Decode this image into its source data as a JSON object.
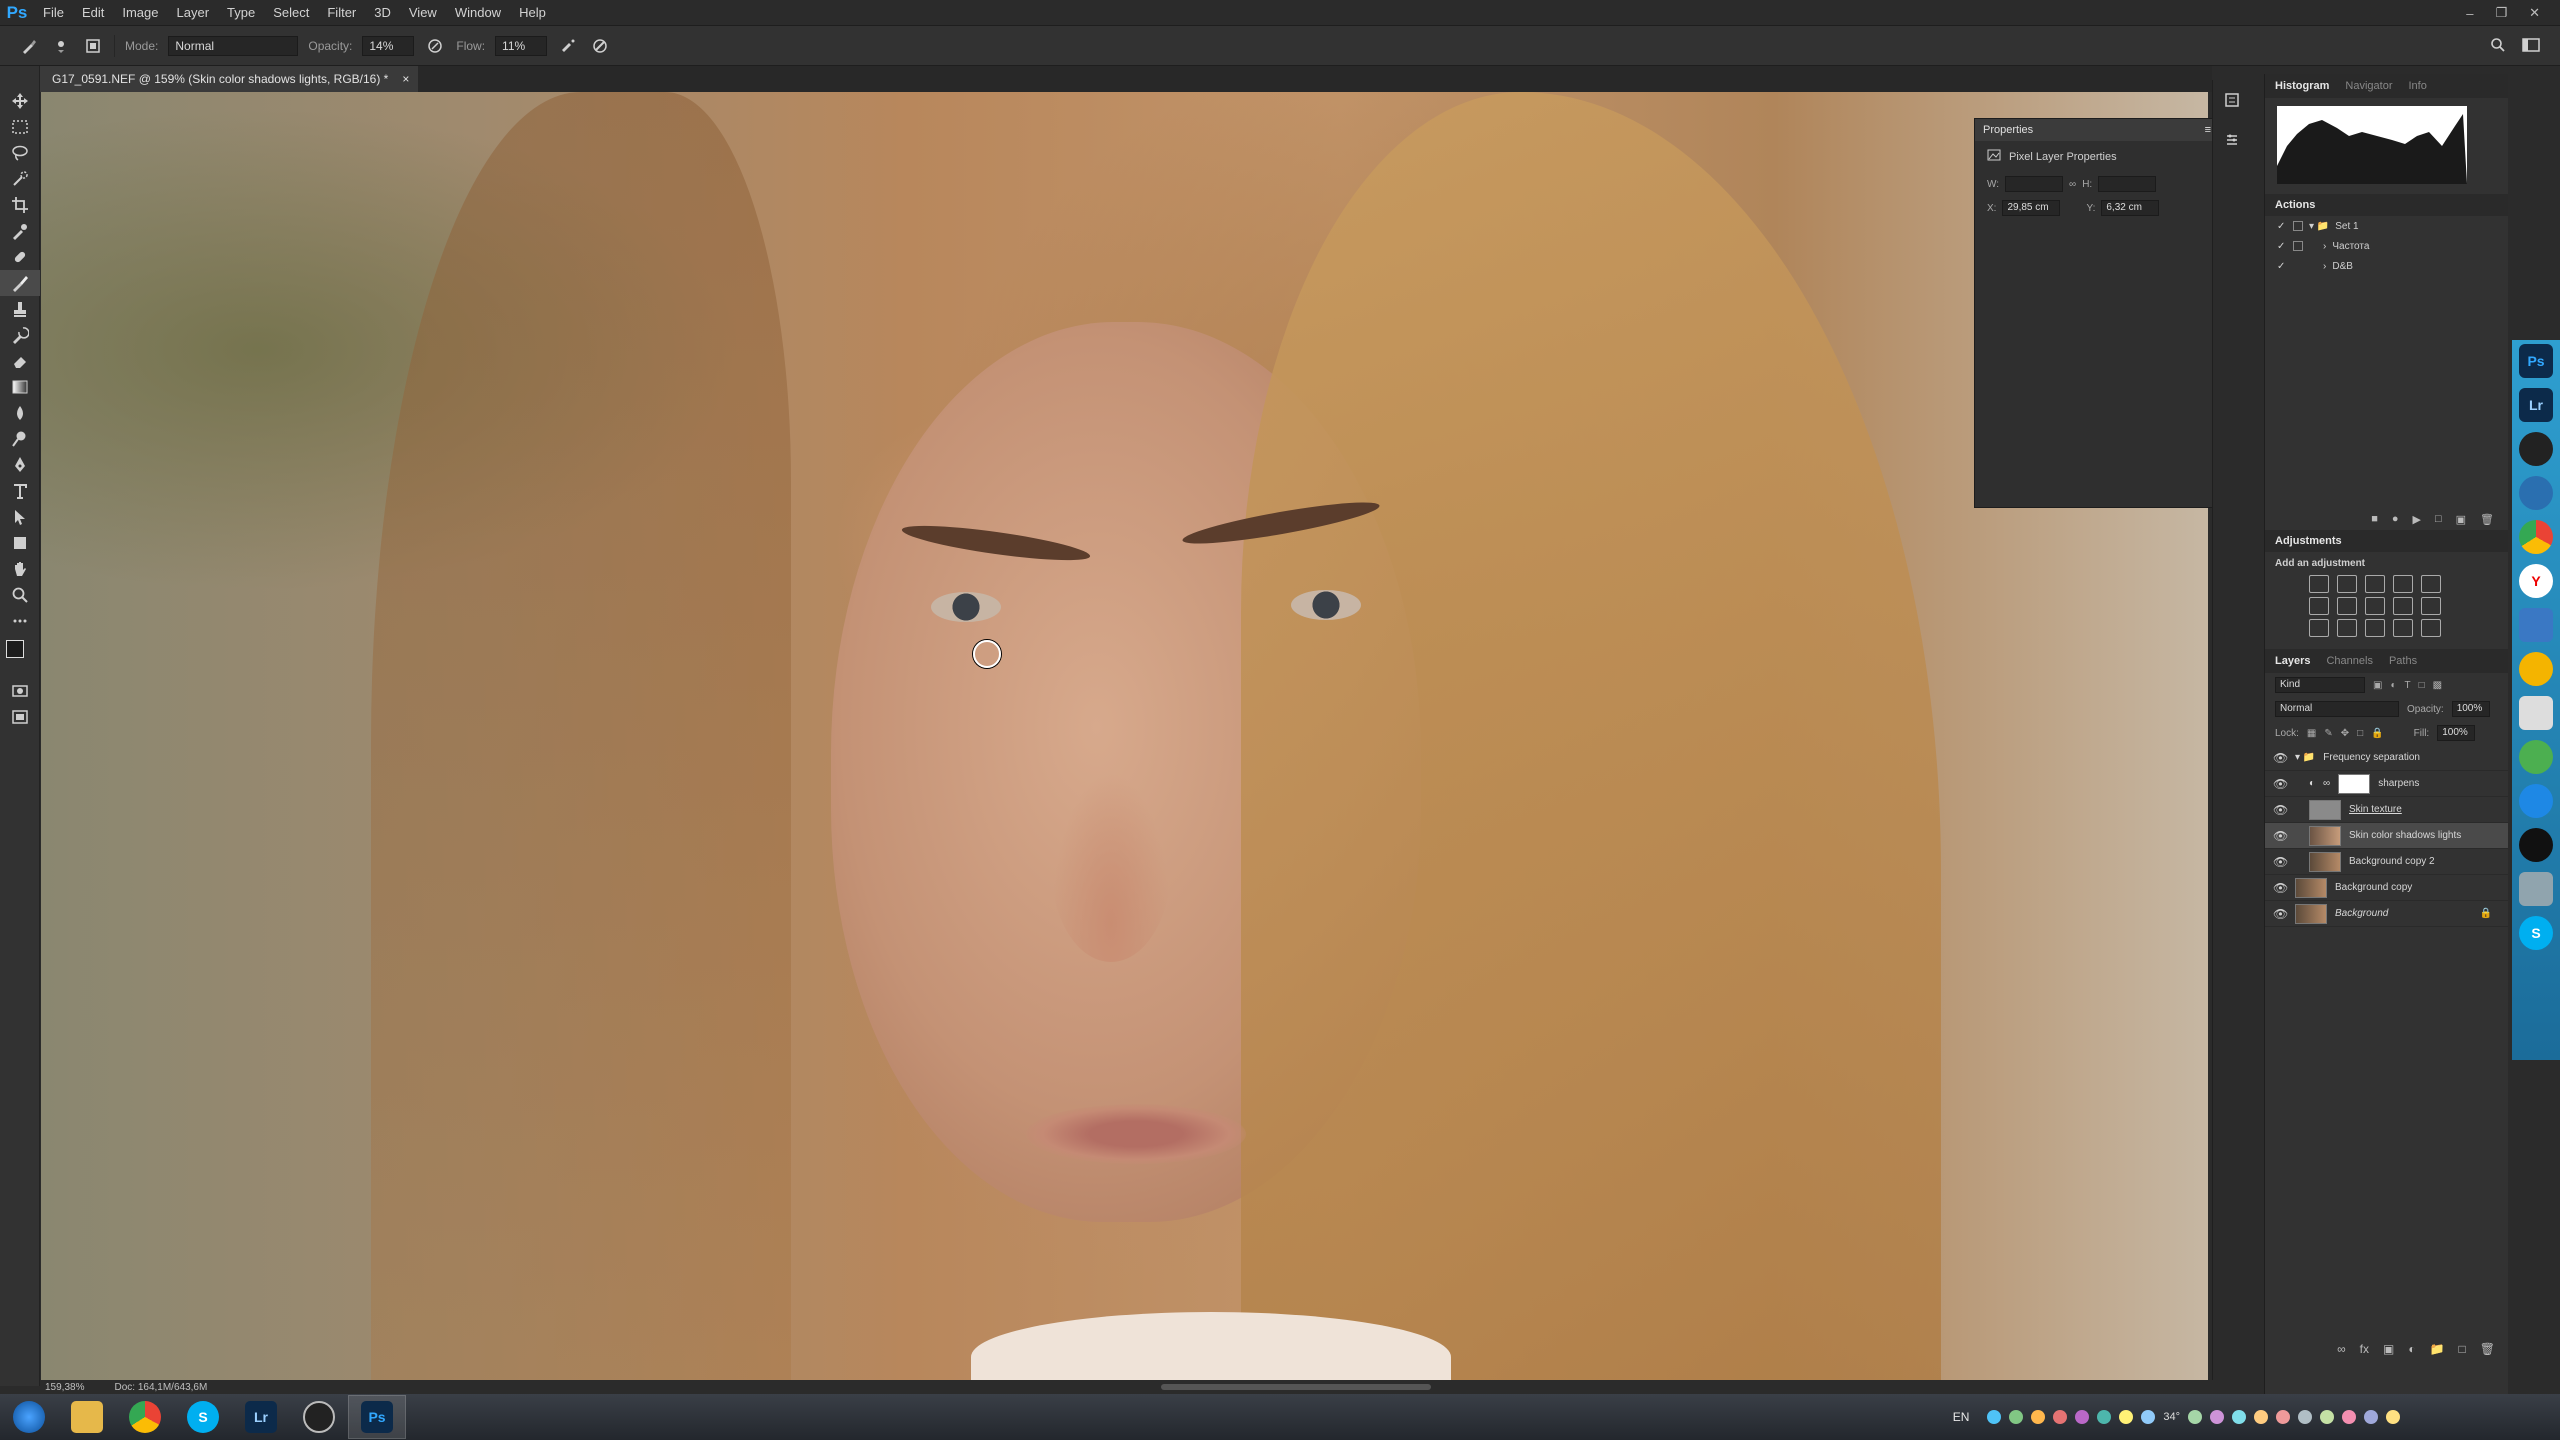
{
  "menubar": {
    "app_logo": "Ps",
    "items": [
      "File",
      "Edit",
      "Image",
      "Layer",
      "Type",
      "Select",
      "Filter",
      "3D",
      "View",
      "Window",
      "Help"
    ]
  },
  "options": {
    "mode_label": "Mode:",
    "mode_value": "Normal",
    "opacity_label": "Opacity:",
    "opacity_value": "14%",
    "flow_label": "Flow:",
    "flow_value": "11%"
  },
  "document": {
    "tab_title": "G17_0591.NEF @ 159% (Skin color shadows lights, RGB/16) *",
    "tab_close": "×"
  },
  "status": {
    "zoom": "159,38%",
    "doc_size": "Doc: 164,1M/643,6M"
  },
  "properties": {
    "title": "Properties",
    "subtitle": "Pixel Layer Properties",
    "w_label": "W:",
    "h_label": "H:",
    "x_label": "X:",
    "x_value": "29,85 cm",
    "y_label": "Y:",
    "y_value": "6,32 cm"
  },
  "histogram_panel": {
    "tabs": [
      "Histogram",
      "Navigator",
      "Info"
    ]
  },
  "actions": {
    "title": "Actions",
    "items": [
      {
        "label": "Set 1"
      },
      {
        "label": "Частота"
      },
      {
        "label": "D&B"
      }
    ]
  },
  "adjustments": {
    "title": "Adjustments",
    "subtitle": "Add an adjustment"
  },
  "layers": {
    "tabs": [
      "Layers",
      "Channels",
      "Paths"
    ],
    "kind_label": "Kind",
    "blend_mode": "Normal",
    "opacity_label": "Opacity:",
    "opacity_value": "100%",
    "lock_label": "Lock:",
    "fill_label": "Fill:",
    "fill_value": "100%",
    "items": [
      {
        "name": "Frequency separation",
        "type": "group",
        "selected": false
      },
      {
        "name": "sharpens",
        "type": "adjustment",
        "selected": false
      },
      {
        "name": "Skin texture",
        "type": "pixel",
        "selected": false
      },
      {
        "name": "Skin color shadows lights",
        "type": "pixel",
        "selected": true
      },
      {
        "name": "Background copy 2",
        "type": "pixel",
        "selected": false
      },
      {
        "name": "Background copy",
        "type": "pixel",
        "selected": false
      },
      {
        "name": "Background",
        "type": "pixel-locked",
        "selected": false
      }
    ]
  },
  "appbar": {
    "apps": [
      "Ps",
      "Lr",
      "S"
    ]
  },
  "taskbar": {
    "apps": [
      "S",
      "Lr",
      "Ps"
    ],
    "language": "EN",
    "temperature": "34°"
  },
  "colors": {
    "ps_blue": "#31a8ff",
    "panel_bg": "#323232",
    "selected_layer": "#4a4a4a"
  }
}
